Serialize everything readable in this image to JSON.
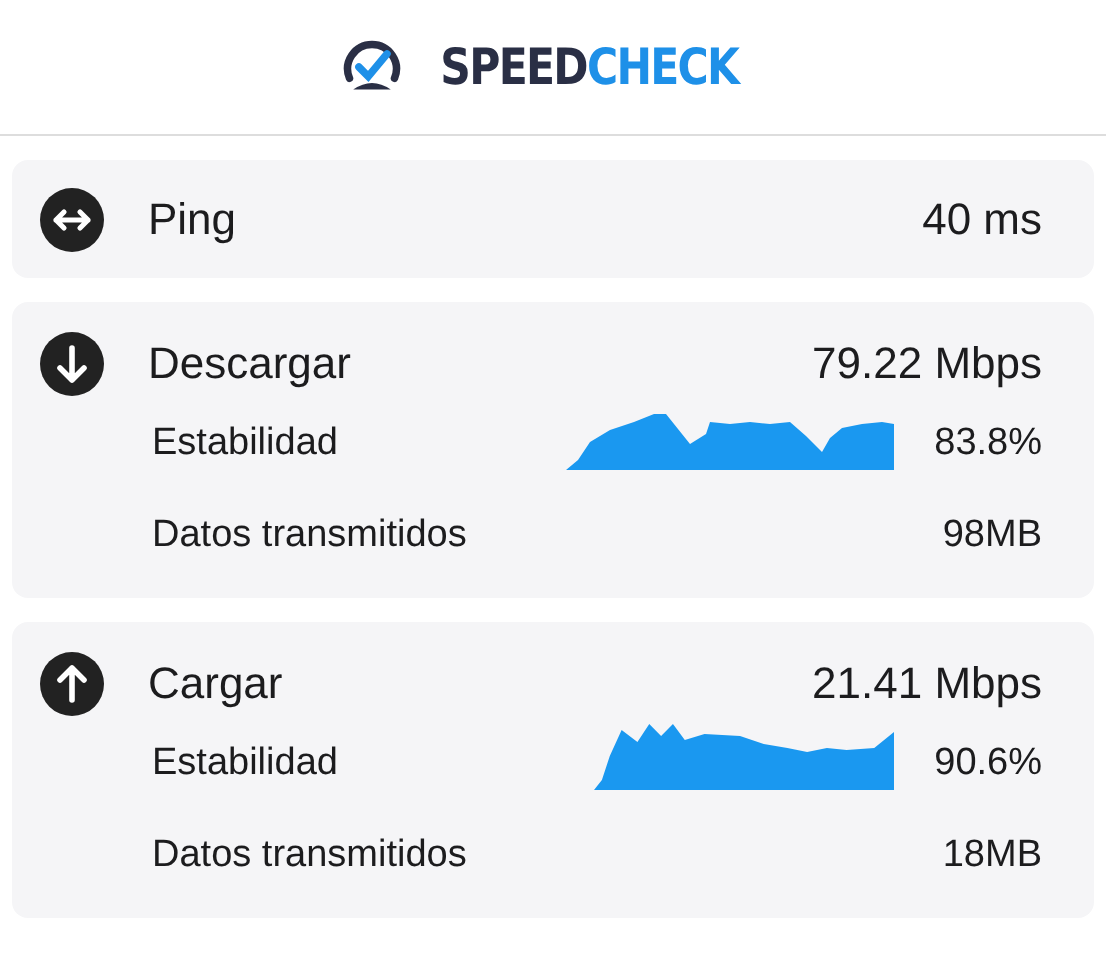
{
  "logo": {
    "dark_part": "SPEED",
    "blue_part": "CHECK"
  },
  "ping": {
    "label": "Ping",
    "value": "40 ms"
  },
  "sections": [
    {
      "kind": "download",
      "label": "Descargar",
      "value": "79.22 Mbps",
      "stability_label": "Estabilidad",
      "stability_value": "83.8%",
      "data_label": "Datos transmitidos",
      "data_value": "98MB"
    },
    {
      "kind": "upload",
      "label": "Cargar",
      "value": "21.41 Mbps",
      "stability_label": "Estabilidad",
      "stability_value": "90.6%",
      "data_label": "Datos transmitidos",
      "data_value": "18MB"
    }
  ]
}
